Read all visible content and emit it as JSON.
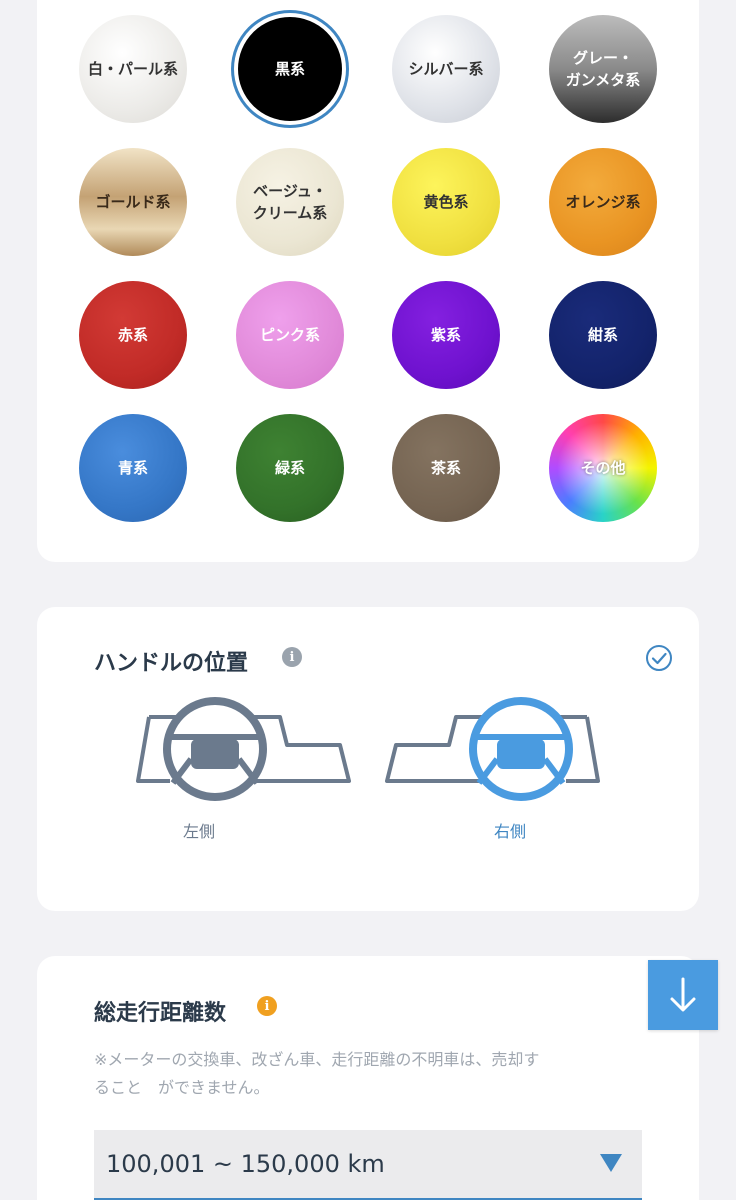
{
  "colors": [
    {
      "label": "白・パール系"
    },
    {
      "label": "黒系"
    },
    {
      "label": "シルバー系"
    },
    {
      "label": "グレー・\nガンメタ系"
    },
    {
      "label": "ゴールド系"
    },
    {
      "label": "ベージュ・\nクリーム系"
    },
    {
      "label": "黄色系"
    },
    {
      "label": "オレンジ系"
    },
    {
      "label": "赤系"
    },
    {
      "label": "ピンク系"
    },
    {
      "label": "紫系"
    },
    {
      "label": "紺系"
    },
    {
      "label": "青系"
    },
    {
      "label": "緑系"
    },
    {
      "label": "茶系"
    },
    {
      "label": "その他"
    }
  ],
  "handle": {
    "title": "ハンドルの位置",
    "left_label": "左側",
    "right_label": "右側",
    "selected": "右側"
  },
  "mileage": {
    "title": "総走行距離数",
    "note": "※メーター の交換車、改ざん車、走行距離の不明車は、売却することができません。",
    "note_line1": "※メーターの交換車、改ざん車、走行距離の不明車は、売却す",
    "note_line2": "ること　ができません。",
    "selected_value": "100,001 ~ 150,000 km"
  },
  "theme": {
    "accent": "#3f86c2",
    "info_gray": "#9aa3ad",
    "info_orange": "#f0a020",
    "unselected_handle": "#6b7a8d",
    "selected_handle": "#4a9be0"
  }
}
